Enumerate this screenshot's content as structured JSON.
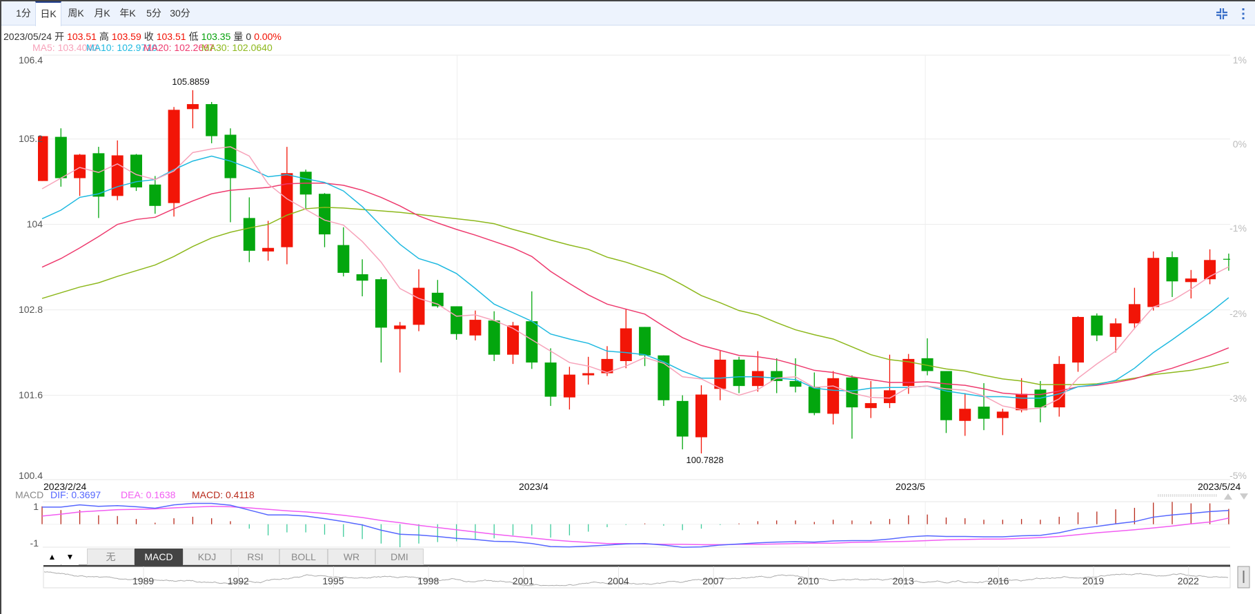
{
  "toolbar": {
    "tabs": [
      "1分",
      "日K",
      "周K",
      "月K",
      "年K",
      "5分",
      "30分"
    ],
    "active_index": 1,
    "compress_icon": "compress-icon",
    "more_icon": "more-vertical-icon"
  },
  "info": {
    "date": "2023/05/24",
    "open_label": "开",
    "open": "103.51",
    "high_label": "高",
    "high": "103.59",
    "close_label": "收",
    "close": "103.51",
    "low_label": "低",
    "low": "103.35",
    "volume_label": "量",
    "volume": "0",
    "change": "0.00%"
  },
  "ma_legend": {
    "ma5": "MA5: 103.4040",
    "ma10": "MA10: 102.9710",
    "ma20": "MA20: 102.2667",
    "ma30": "MA30: 102.0640"
  },
  "colors": {
    "up": "#f21507",
    "down": "#03a60e",
    "ma5": "#f7a3ba",
    "ma10": "#1eb9e0",
    "ma20": "#ee3a6e",
    "ma30": "#8db81c",
    "dif": "#5566ff",
    "dea": "#f25cf2",
    "macd_pos": "#b8291a",
    "macd_neg": "#3ccb9a"
  },
  "chart_data": {
    "type": "candlestick",
    "y_ticks": [
      "106.4",
      "105.2",
      "104",
      "102.8",
      "101.6",
      "100.4"
    ],
    "y_tick_values": [
      106.4,
      105.2,
      104,
      102.8,
      101.6,
      100.4
    ],
    "pct_ticks": [
      "1%",
      "0%",
      "-1%",
      "-2%",
      "-3%",
      "-5%"
    ],
    "x_labels": [
      "2023/2/24",
      "2023/4",
      "2023/5",
      "2023/5/24"
    ],
    "x_label_index": [
      0,
      22,
      47,
      63
    ],
    "ylim": [
      100.4,
      106.4
    ],
    "high_label": "105.8859",
    "low_label": "100.7828",
    "high_index": 8,
    "low_index": 35,
    "ohlc": [
      [
        104.61,
        105.24,
        104.61,
        105.24
      ],
      [
        105.23,
        105.35,
        104.53,
        104.65
      ],
      [
        104.65,
        104.99,
        104.4,
        104.98
      ],
      [
        105.0,
        105.09,
        104.09,
        104.39
      ],
      [
        104.4,
        105.18,
        104.34,
        104.97
      ],
      [
        104.98,
        104.99,
        104.47,
        104.52
      ],
      [
        104.56,
        104.68,
        104.15,
        104.26
      ],
      [
        104.3,
        105.65,
        104.11,
        105.61
      ],
      [
        105.62,
        105.8859,
        105.35,
        105.69
      ],
      [
        105.69,
        105.72,
        105.14,
        105.24
      ],
      [
        105.26,
        105.35,
        104.03,
        104.65
      ],
      [
        104.09,
        104.38,
        103.47,
        103.63
      ],
      [
        103.62,
        104.05,
        103.49,
        103.67
      ],
      [
        103.68,
        105.09,
        103.44,
        104.72
      ],
      [
        104.74,
        104.77,
        104.22,
        104.42
      ],
      [
        104.43,
        104.44,
        103.68,
        103.86
      ],
      [
        103.71,
        103.96,
        103.27,
        103.32
      ],
      [
        103.3,
        103.51,
        102.99,
        103.21
      ],
      [
        103.23,
        103.26,
        102.06,
        102.55
      ],
      [
        102.53,
        102.63,
        101.92,
        102.58
      ],
      [
        102.59,
        103.37,
        102.5,
        103.11
      ],
      [
        103.04,
        103.22,
        102.83,
        102.85
      ],
      [
        102.85,
        102.85,
        102.38,
        102.46
      ],
      [
        102.44,
        102.79,
        102.37,
        102.66
      ],
      [
        102.65,
        102.78,
        102.08,
        102.17
      ],
      [
        102.17,
        102.63,
        102.04,
        102.58
      ],
      [
        102.64,
        103.06,
        101.97,
        102.06
      ],
      [
        102.06,
        102.26,
        101.45,
        101.58
      ],
      [
        101.57,
        102.0,
        101.4,
        101.89
      ],
      [
        101.88,
        102.14,
        101.75,
        101.91
      ],
      [
        101.91,
        102.29,
        101.87,
        102.11
      ],
      [
        102.08,
        102.81,
        101.98,
        102.54
      ],
      [
        102.56,
        102.56,
        102.01,
        102.16
      ],
      [
        102.16,
        102.16,
        101.45,
        101.53
      ],
      [
        101.52,
        101.6,
        100.84,
        101.02
      ],
      [
        101.01,
        101.74,
        100.7828,
        101.61
      ],
      [
        101.69,
        102.23,
        101.53,
        102.1
      ],
      [
        102.1,
        102.14,
        101.63,
        101.73
      ],
      [
        101.73,
        102.22,
        101.65,
        101.94
      ],
      [
        101.94,
        102.12,
        101.63,
        101.8
      ],
      [
        101.8,
        102.12,
        101.64,
        101.72
      ],
      [
        101.72,
        101.92,
        101.32,
        101.35
      ],
      [
        101.34,
        101.94,
        101.19,
        101.84
      ],
      [
        101.85,
        101.88,
        100.99,
        101.43
      ],
      [
        101.42,
        101.8,
        101.28,
        101.49
      ],
      [
        101.49,
        102.17,
        101.42,
        101.67
      ],
      [
        101.73,
        102.18,
        101.62,
        102.11
      ],
      [
        102.12,
        102.4,
        101.88,
        101.94
      ],
      [
        101.94,
        101.94,
        101.07,
        101.25
      ],
      [
        101.24,
        101.63,
        101.03,
        101.41
      ],
      [
        101.44,
        101.77,
        101.11,
        101.27
      ],
      [
        101.28,
        101.41,
        101.04,
        101.37
      ],
      [
        101.39,
        101.84,
        101.36,
        101.62
      ],
      [
        101.68,
        101.8,
        101.22,
        101.43
      ],
      [
        101.43,
        102.15,
        101.3,
        102.04
      ],
      [
        102.06,
        102.71,
        101.93,
        102.7
      ],
      [
        102.72,
        102.75,
        102.36,
        102.44
      ],
      [
        102.42,
        102.68,
        102.2,
        102.61
      ],
      [
        102.61,
        103.11,
        102.53,
        102.88
      ],
      [
        102.84,
        103.62,
        102.79,
        103.53
      ],
      [
        103.54,
        103.62,
        102.98,
        103.2
      ],
      [
        103.19,
        103.36,
        102.96,
        103.24
      ],
      [
        103.23,
        103.65,
        103.16,
        103.5
      ],
      [
        103.51,
        103.59,
        103.35,
        103.51
      ]
    ],
    "ma5": [
      104.5,
      104.65,
      104.8,
      104.73,
      104.85,
      104.7,
      104.63,
      104.75,
      105.01,
      105.06,
      105.09,
      104.96,
      104.57,
      104.36,
      104.21,
      104.06,
      103.99,
      103.76,
      103.47,
      103.1,
      102.96,
      102.88,
      102.71,
      102.73,
      102.65,
      102.54,
      102.38,
      102.22,
      102.06,
      102.01,
      101.92,
      102.01,
      102.13,
      102.05,
      101.86,
      101.83,
      101.7,
      101.6,
      101.68,
      101.84,
      101.86,
      101.71,
      101.73,
      101.63,
      101.57,
      101.56,
      101.71,
      101.73,
      101.69,
      101.67,
      101.59,
      101.45,
      101.4,
      101.42,
      101.55,
      101.84,
      102.04,
      102.22,
      102.54,
      102.84,
      102.93,
      103.09,
      103.27,
      103.404
    ],
    "ma10": [
      104.08,
      104.2,
      104.38,
      104.43,
      104.53,
      104.6,
      104.63,
      104.77,
      104.89,
      104.96,
      104.89,
      104.79,
      104.67,
      104.7,
      104.64,
      104.59,
      104.47,
      104.25,
      103.98,
      103.72,
      103.52,
      103.44,
      103.31,
      103.1,
      102.88,
      102.76,
      102.64,
      102.46,
      102.39,
      102.33,
      102.22,
      102.2,
      102.17,
      102.07,
      101.94,
      101.84,
      101.84,
      101.86,
      101.86,
      101.84,
      101.82,
      101.7,
      101.67,
      101.66,
      101.7,
      101.71,
      101.71,
      101.73,
      101.66,
      101.62,
      101.58,
      101.58,
      101.56,
      101.56,
      101.62,
      101.72,
      101.75,
      101.81,
      101.98,
      102.2,
      102.38,
      102.57,
      102.76,
      102.971
    ],
    "ma20": [
      103.4,
      103.52,
      103.67,
      103.83,
      104.0,
      104.07,
      104.1,
      104.22,
      104.33,
      104.43,
      104.48,
      104.5,
      104.52,
      104.57,
      104.58,
      104.58,
      104.55,
      104.48,
      104.38,
      104.26,
      104.12,
      104.02,
      103.93,
      103.85,
      103.76,
      103.67,
      103.55,
      103.34,
      103.17,
      103.01,
      102.88,
      102.81,
      102.74,
      102.57,
      102.41,
      102.3,
      102.23,
      102.16,
      102.14,
      102.1,
      102.03,
      101.95,
      101.92,
      101.86,
      101.82,
      101.78,
      101.78,
      101.79,
      101.76,
      101.74,
      101.69,
      101.63,
      101.61,
      101.61,
      101.66,
      101.72,
      101.74,
      101.78,
      101.83,
      101.91,
      101.98,
      102.07,
      102.16,
      102.2667
    ],
    "ma30": [
      102.96,
      103.04,
      103.12,
      103.18,
      103.27,
      103.35,
      103.43,
      103.55,
      103.69,
      103.81,
      103.89,
      103.95,
      104.0,
      104.13,
      104.22,
      104.24,
      104.23,
      104.21,
      104.19,
      104.17,
      104.14,
      104.11,
      104.08,
      104.05,
      104.01,
      103.93,
      103.86,
      103.78,
      103.71,
      103.65,
      103.54,
      103.47,
      103.38,
      103.29,
      103.15,
      103.0,
      102.9,
      102.79,
      102.73,
      102.62,
      102.52,
      102.45,
      102.39,
      102.28,
      102.17,
      102.1,
      102.07,
      102.02,
      101.97,
      101.94,
      101.88,
      101.83,
      101.8,
      101.75,
      101.75,
      101.75,
      101.76,
      101.8,
      101.84,
      101.89,
      101.92,
      101.95,
      102.0,
      102.064
    ],
    "macd": {
      "label": "MACD",
      "dif_label": "DIF: 0.3697",
      "dea_label": "DEA: 0.1638",
      "macd_label": "MACD: 0.4118",
      "y_labels": [
        "1",
        "-1"
      ],
      "dif": [
        0.46,
        0.46,
        0.52,
        0.48,
        0.5,
        0.47,
        0.43,
        0.52,
        0.56,
        0.56,
        0.51,
        0.38,
        0.25,
        0.25,
        0.22,
        0.15,
        0.07,
        -0.02,
        -0.16,
        -0.27,
        -0.29,
        -0.33,
        -0.38,
        -0.41,
        -0.46,
        -0.47,
        -0.52,
        -0.6,
        -0.61,
        -0.59,
        -0.56,
        -0.53,
        -0.52,
        -0.56,
        -0.62,
        -0.61,
        -0.56,
        -0.53,
        -0.5,
        -0.48,
        -0.47,
        -0.48,
        -0.45,
        -0.44,
        -0.44,
        -0.4,
        -0.34,
        -0.31,
        -0.33,
        -0.33,
        -0.34,
        -0.34,
        -0.31,
        -0.3,
        -0.23,
        -0.12,
        -0.06,
        0.01,
        0.07,
        0.19,
        0.25,
        0.29,
        0.34,
        0.3697
      ],
      "dea": [
        0.22,
        0.27,
        0.33,
        0.36,
        0.39,
        0.4,
        0.41,
        0.44,
        0.46,
        0.48,
        0.47,
        0.44,
        0.4,
        0.36,
        0.33,
        0.29,
        0.24,
        0.18,
        0.1,
        0.04,
        -0.03,
        -0.09,
        -0.15,
        -0.21,
        -0.27,
        -0.32,
        -0.37,
        -0.42,
        -0.46,
        -0.49,
        -0.52,
        -0.52,
        -0.53,
        -0.54,
        -0.54,
        -0.55,
        -0.55,
        -0.54,
        -0.54,
        -0.53,
        -0.52,
        -0.51,
        -0.51,
        -0.49,
        -0.48,
        -0.47,
        -0.46,
        -0.44,
        -0.42,
        -0.41,
        -0.4,
        -0.4,
        -0.38,
        -0.36,
        -0.33,
        -0.28,
        -0.23,
        -0.19,
        -0.15,
        -0.1,
        -0.05,
        0.01,
        0.06,
        0.1638
      ]
    }
  },
  "indicator_tabs": {
    "up_arrow": "▲",
    "down_arrow": "▼",
    "tabs": [
      "无",
      "MACD",
      "KDJ",
      "RSI",
      "BOLL",
      "WR",
      "DMI"
    ],
    "active_index": 1
  },
  "navigator": {
    "years": [
      "1989",
      "1992",
      "1995",
      "1998",
      "2001",
      "2004",
      "2007",
      "2010",
      "2013",
      "2016",
      "2019",
      "2022"
    ]
  }
}
